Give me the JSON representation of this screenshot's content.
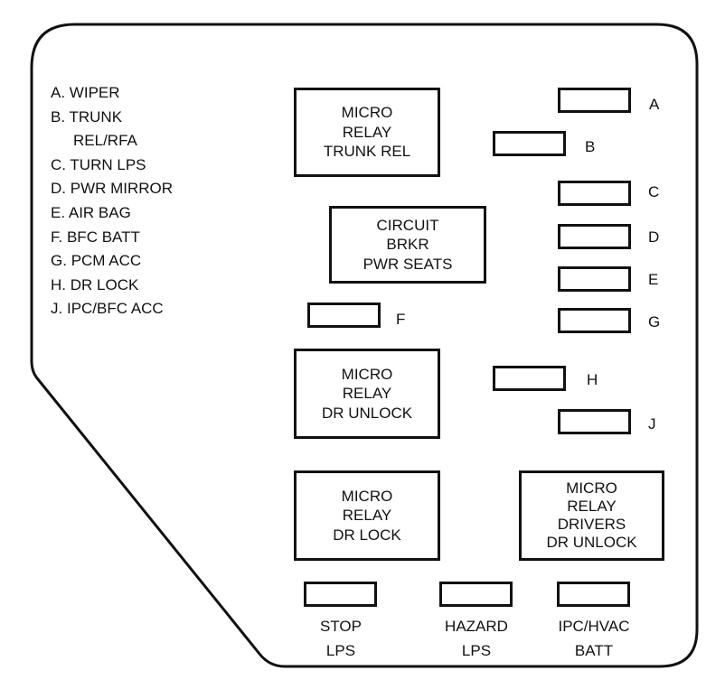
{
  "legend": {
    "items": [
      {
        "key": "A.",
        "text": "WIPER"
      },
      {
        "key": "B.",
        "text": "TRUNK",
        "cont": "REL/RFA"
      },
      {
        "key": "C.",
        "text": "TURN LPS"
      },
      {
        "key": "D.",
        "text": "PWR MIRROR"
      },
      {
        "key": "E.",
        "text": "AIR BAG"
      },
      {
        "key": "F.",
        "text": "BFC BATT"
      },
      {
        "key": "G.",
        "text": "PCM ACC"
      },
      {
        "key": "H.",
        "text": "DR LOCK"
      },
      {
        "key": "J.",
        "text": "IPC/BFC ACC"
      }
    ]
  },
  "relays": {
    "trunk_rel": {
      "lines": [
        "MICRO",
        "RELAY",
        "TRUNK REL"
      ]
    },
    "circuit_brkr": {
      "lines": [
        "CIRCUIT",
        "BRKR",
        "PWR SEATS"
      ]
    },
    "dr_unlock": {
      "lines": [
        "MICRO",
        "RELAY",
        "DR UNLOCK"
      ]
    },
    "dr_lock": {
      "lines": [
        "MICRO",
        "RELAY",
        "DR LOCK"
      ]
    },
    "drivers_dr_unlock": {
      "lines": [
        "MICRO",
        "RELAY",
        "DRIVERS",
        "DR UNLOCK"
      ]
    }
  },
  "fuses": {
    "A": "A",
    "B": "B",
    "C": "C",
    "D": "D",
    "E": "E",
    "F": "F",
    "G": "G",
    "H": "H",
    "J": "J"
  },
  "bottom_fuses": {
    "stop": {
      "line1": "STOP",
      "line2": "LPS"
    },
    "hazard": {
      "line1": "HAZARD",
      "line2": "LPS"
    },
    "ipc_hvac": {
      "line1": "IPC/HVAC",
      "line2": "BATT"
    }
  },
  "colors": {
    "stroke": "#111111",
    "background": "#ffffff"
  }
}
